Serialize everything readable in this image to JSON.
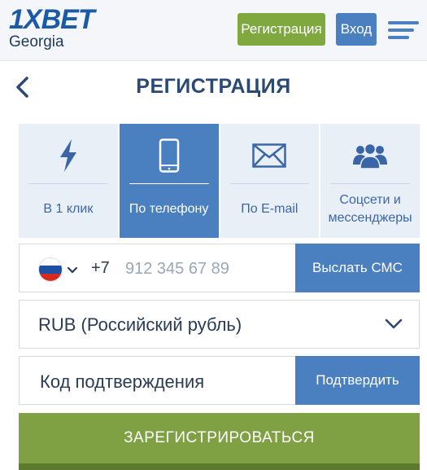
{
  "header": {
    "logo_text": "1XBET",
    "logo_region": "Georgia",
    "register_button": "Регистрация",
    "login_button": "Вход",
    "menu_icon": "hamburger-menu-icon"
  },
  "page": {
    "title": "РЕГИСТРАЦИЯ",
    "back_icon": "chevron-left-icon"
  },
  "tabs": [
    {
      "label": "В 1 клик",
      "icon": "lightning-icon",
      "active": false
    },
    {
      "label": "По телефону",
      "icon": "phone-icon",
      "active": true
    },
    {
      "label": "По E-mail",
      "icon": "envelope-icon",
      "active": false
    },
    {
      "label": "Соцсети и мессенджеры",
      "icon": "users-icon",
      "active": false
    }
  ],
  "phone": {
    "country_flag": "russia-flag-icon",
    "code": "+7",
    "placeholder": "912 345 67 89",
    "send_sms_button": "Выслать СМС"
  },
  "currency": {
    "selected": "RUB (Российский рубль)"
  },
  "confirmation": {
    "placeholder": "Код подтверждения",
    "confirm_button": "Подтвердить"
  },
  "submit_button": "ЗАРЕГИСТРИРОВАТЬСЯ",
  "colors": {
    "brand_blue": "#1a5aa6",
    "accent_blue": "#4a7fc0",
    "accent_green": "#7fa043",
    "tab_bg": "#e9eff6"
  }
}
